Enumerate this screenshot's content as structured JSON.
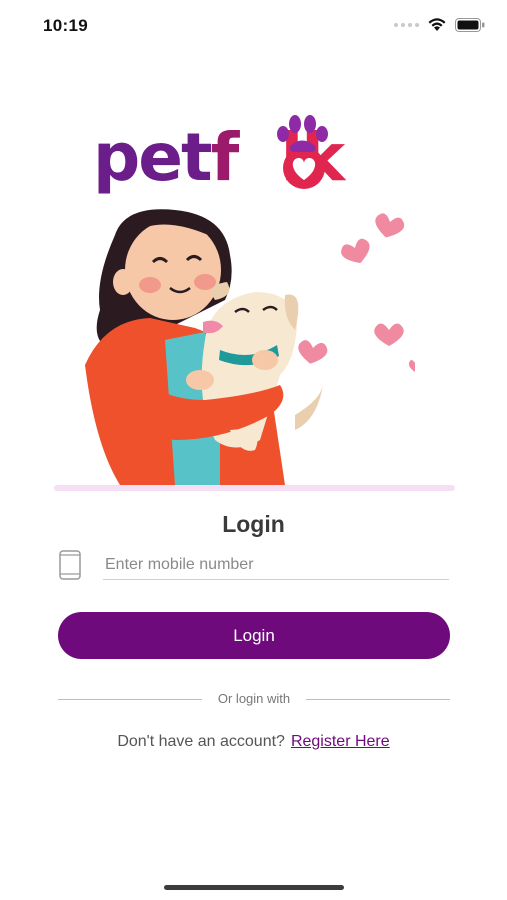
{
  "status_bar": {
    "time": "10:19",
    "icons": [
      "signal-dots-icon",
      "wifi-icon",
      "battery-icon"
    ]
  },
  "logo": {
    "prefix": "pet",
    "f": "f",
    "o": "o",
    "suffix": "lk"
  },
  "form": {
    "title": "Login",
    "phone_placeholder": "Enter mobile number",
    "phone_value": "",
    "login_button": "Login",
    "or_text": "Or login with",
    "no_account_text": "Don't have an account?",
    "register_link": "Register Here"
  },
  "colors": {
    "primary": "#6e0a7c",
    "logo_purple": "#6b1e8a",
    "logo_pink": "#e0264f",
    "hero_divider": "#f4dff5"
  }
}
